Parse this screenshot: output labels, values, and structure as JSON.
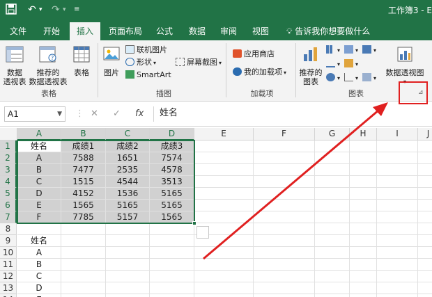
{
  "quick_access": {
    "save_icon": "save-icon",
    "undo_icon": "undo-icon",
    "redo_icon": "redo-icon",
    "customize_icon": "customize-icon"
  },
  "window": {
    "title": "工作簿3 - E"
  },
  "tabs": [
    {
      "label": "文件",
      "active": false
    },
    {
      "label": "开始",
      "active": false
    },
    {
      "label": "插入",
      "active": true
    },
    {
      "label": "页面布局",
      "active": false
    },
    {
      "label": "公式",
      "active": false
    },
    {
      "label": "数据",
      "active": false
    },
    {
      "label": "审阅",
      "active": false
    },
    {
      "label": "视图",
      "active": false
    }
  ],
  "tell_me": {
    "text": "告诉我你想要做什么"
  },
  "ribbon": {
    "tables": {
      "group_label": "表格",
      "pivot_line1": "数据",
      "pivot_line2": "透视表",
      "rec_pivot_line1": "推荐的",
      "rec_pivot_line2": "数据透视表",
      "table": "表格"
    },
    "illustrations": {
      "group_label": "插图",
      "pictures": "图片",
      "online_pictures": "联机图片",
      "shapes": "形状",
      "smartart": "SmartArt",
      "screenshot": "屏幕截图"
    },
    "addins": {
      "group_label": "加载项",
      "store": "应用商店",
      "my_addins": "我的加载项"
    },
    "charts": {
      "group_label": "图表",
      "rec_charts_line1": "推荐的",
      "rec_charts_line2": "图表",
      "pivot_chart": "数据透视图"
    }
  },
  "formula_bar": {
    "name_box": "A1",
    "cancel": "✕",
    "enter": "✓",
    "fx": "fx",
    "value": "姓名"
  },
  "columns": [
    "A",
    "B",
    "C",
    "D",
    "E",
    "F",
    "G",
    "H",
    "I",
    "J"
  ],
  "rows": [
    [
      "姓名",
      "成绩1",
      "成绩2",
      "成绩3"
    ],
    [
      "A",
      "7588",
      "1651",
      "7574"
    ],
    [
      "B",
      "7477",
      "2535",
      "4578"
    ],
    [
      "C",
      "1515",
      "4544",
      "3513"
    ],
    [
      "D",
      "4152",
      "1536",
      "5165"
    ],
    [
      "E",
      "1565",
      "5165",
      "5165"
    ],
    [
      "F",
      "7785",
      "5157",
      "1565"
    ],
    [
      ""
    ],
    [
      "姓名"
    ],
    [
      "A"
    ],
    [
      "B"
    ],
    [
      "C"
    ],
    [
      "D"
    ],
    [
      "E"
    ]
  ],
  "row_numbers": [
    "1",
    "2",
    "3",
    "4",
    "5",
    "6",
    "7",
    "8",
    "9",
    "10",
    "11",
    "12",
    "13",
    "14"
  ],
  "colors": {
    "accent": "#217346",
    "annotation": "#e02020"
  }
}
